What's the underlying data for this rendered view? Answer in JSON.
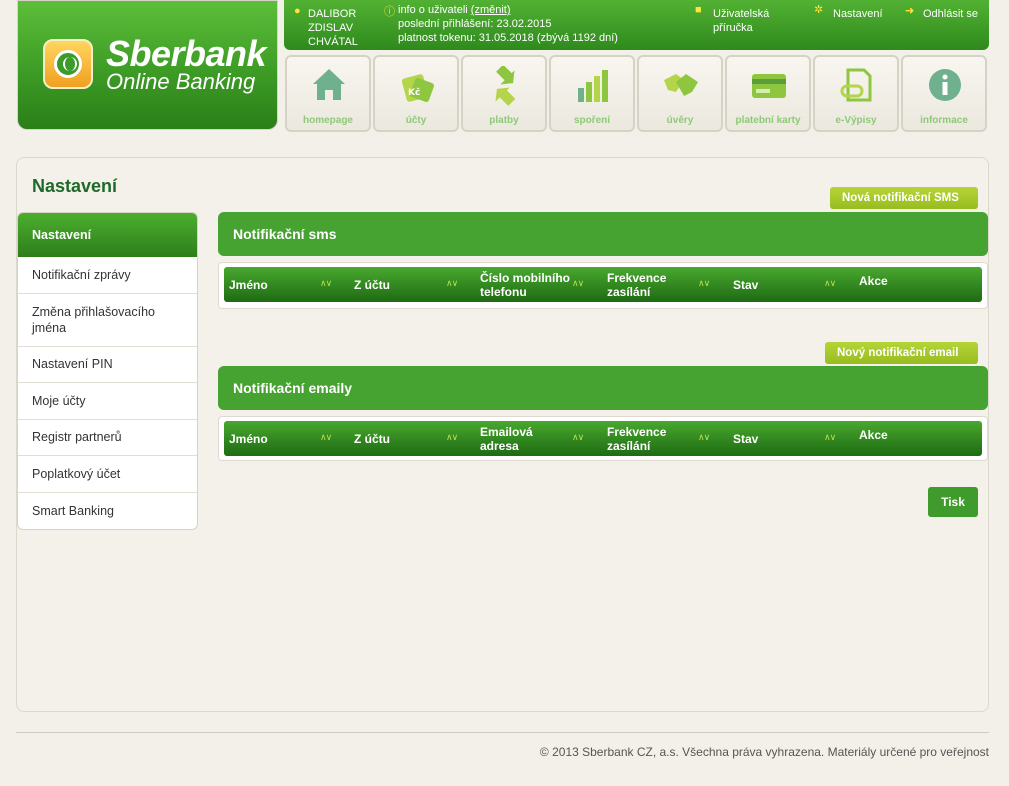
{
  "logo": {
    "title": "Sberbank",
    "subtitle": "Online Banking"
  },
  "topbar": {
    "user_name_line1": "DALIBOR",
    "user_name_line2": "ZDISLAV",
    "user_name_line3": "CHVÁTAL",
    "info_label": "info o uživateli",
    "change_link": "(změnit)",
    "last_login": "poslední přihlášení: 23.02.2015",
    "token_validity": "platnost tokenu: 31.05.2018 (zbývá 1192 dní)",
    "manual_line1": "Uživatelská",
    "manual_line2": "příručka",
    "settings": "Nastavení",
    "logout": "Odhlásit se"
  },
  "nav": {
    "tiles": [
      {
        "label": "homepage",
        "icon": "house-icon"
      },
      {
        "label": "účty",
        "icon": "price-tag-icon"
      },
      {
        "label": "platby",
        "icon": "arrows-icon"
      },
      {
        "label": "spoření",
        "icon": "bar-chart-icon"
      },
      {
        "label": "úvěry",
        "icon": "handshake-icon"
      },
      {
        "label": "platební karty",
        "icon": "card-icon"
      },
      {
        "label": "e-Výpisy",
        "icon": "document-icon"
      },
      {
        "label": "informace",
        "icon": "info-icon"
      }
    ],
    "tag_text": "Kč"
  },
  "page": {
    "title": "Nastavení"
  },
  "sidebar": {
    "items": [
      "Nastavení",
      "Notifikační zprávy",
      "Změna přihlašovacího jména",
      "Nastavení PIN",
      "Moje účty",
      "Registr partnerů",
      "Poplatkový účet",
      "Smart Banking"
    ]
  },
  "sms": {
    "new_button": "Nová notifikační SMS",
    "title": "Notifikační sms",
    "columns": [
      "Jméno",
      "Z účtu",
      "Číslo mobilního telefonu",
      "Frekvence zasílání",
      "Stav",
      "Akce"
    ]
  },
  "email": {
    "new_button": "Nový notifikační email",
    "title": "Notifikační emaily",
    "columns": [
      "Jméno",
      "Z účtu",
      "Emailová adresa",
      "Frekvence zasílání",
      "Stav",
      "Akce"
    ]
  },
  "print_button": "Tisk",
  "footer": "© 2013 Sberbank CZ, a.s. Všechna práva vyhrazena. Materiály určené pro veřejnost",
  "colors": {
    "brand_green": "#46a231",
    "lime": "#a6c82a",
    "title_green": "#1f6a2a"
  }
}
